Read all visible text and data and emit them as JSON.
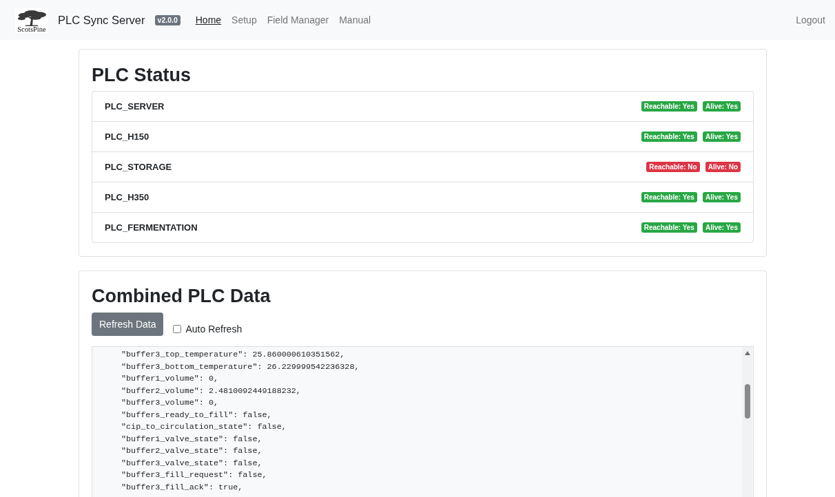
{
  "navbar": {
    "logo_text": "ScotsPine",
    "brand": "PLC Sync Server",
    "version_badge": "v2.0.0",
    "links": [
      {
        "label": "Home",
        "selected": true
      },
      {
        "label": "Setup",
        "selected": false
      },
      {
        "label": "Field Manager",
        "selected": false
      },
      {
        "label": "Manual",
        "selected": false
      }
    ],
    "logout": "Logout"
  },
  "plc_status": {
    "title": "PLC Status",
    "plcs": [
      {
        "name": "PLC_SERVER",
        "badges": [
          {
            "text": "Reachable: Yes",
            "ok": true
          },
          {
            "text": "Alive: Yes",
            "ok": true
          }
        ]
      },
      {
        "name": "PLC_H150",
        "badges": [
          {
            "text": "Reachable: Yes",
            "ok": true
          },
          {
            "text": "Alive: Yes",
            "ok": true
          }
        ]
      },
      {
        "name": "PLC_STORAGE",
        "badges": [
          {
            "text": "Reachable: No",
            "ok": false
          },
          {
            "text": "Alive: No",
            "ok": false
          }
        ]
      },
      {
        "name": "PLC_H350",
        "badges": [
          {
            "text": "Reachable: Yes",
            "ok": true
          },
          {
            "text": "Alive: Yes",
            "ok": true
          }
        ]
      },
      {
        "name": "PLC_FERMENTATION",
        "badges": [
          {
            "text": "Reachable: Yes",
            "ok": true
          },
          {
            "text": "Alive: Yes",
            "ok": true
          }
        ]
      }
    ]
  },
  "combined_data": {
    "title": "Combined PLC Data",
    "refresh_button": "Refresh Data",
    "auto_refresh": {
      "label": "Auto Refresh",
      "checked": false
    },
    "lines": [
      "\"buffer3_top_temperature\": 25.860000610351562,",
      "\"buffer3_bottom_temperature\": 26.229999542236328,",
      "\"buffer1_volume\": 0,",
      "\"buffer2_volume\": 2.4810092449188232,",
      "\"buffer3_volume\": 0,",
      "\"buffers_ready_to_fill\": false,",
      "\"cip_to_circulation_state\": false,",
      "\"buffer1_valve_state\": false,",
      "\"buffer2_valve_state\": false,",
      "\"buffer3_valve_state\": false,",
      "\"buffer3_fill_request\": false,",
      "\"buffer3_fill_ack\": true,"
    ]
  }
}
